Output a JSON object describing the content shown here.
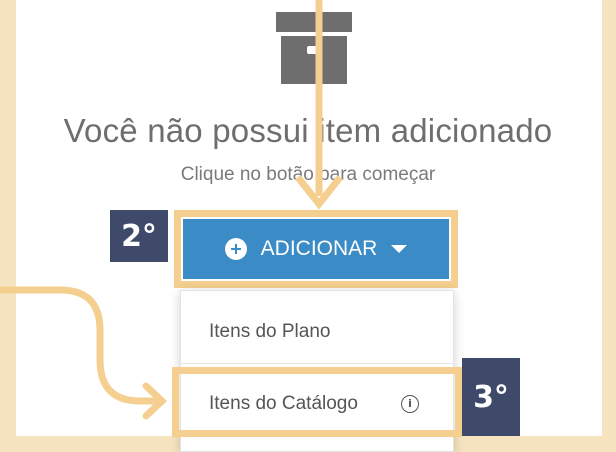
{
  "empty_state": {
    "title": "Você não possui item adicionado",
    "subtitle": "Clique no botão para começar",
    "icon": "archive-box-icon"
  },
  "add_button": {
    "label": "ADICIONAR",
    "icon": "plus-circle-icon",
    "caret": "caret-down-icon"
  },
  "dropdown": {
    "items": [
      {
        "label": "Itens do Plano"
      },
      {
        "label": "Itens do Catálogo",
        "icon": "info-icon"
      }
    ]
  },
  "annotations": {
    "step_2": "2°",
    "step_3": "3°",
    "highlight_color": "#f4cf8f",
    "badge_color": "#3f4a6b"
  },
  "colors": {
    "background": "#f5e4bf",
    "button": "#3a8bc6",
    "text_muted": "#6e6e6e"
  }
}
